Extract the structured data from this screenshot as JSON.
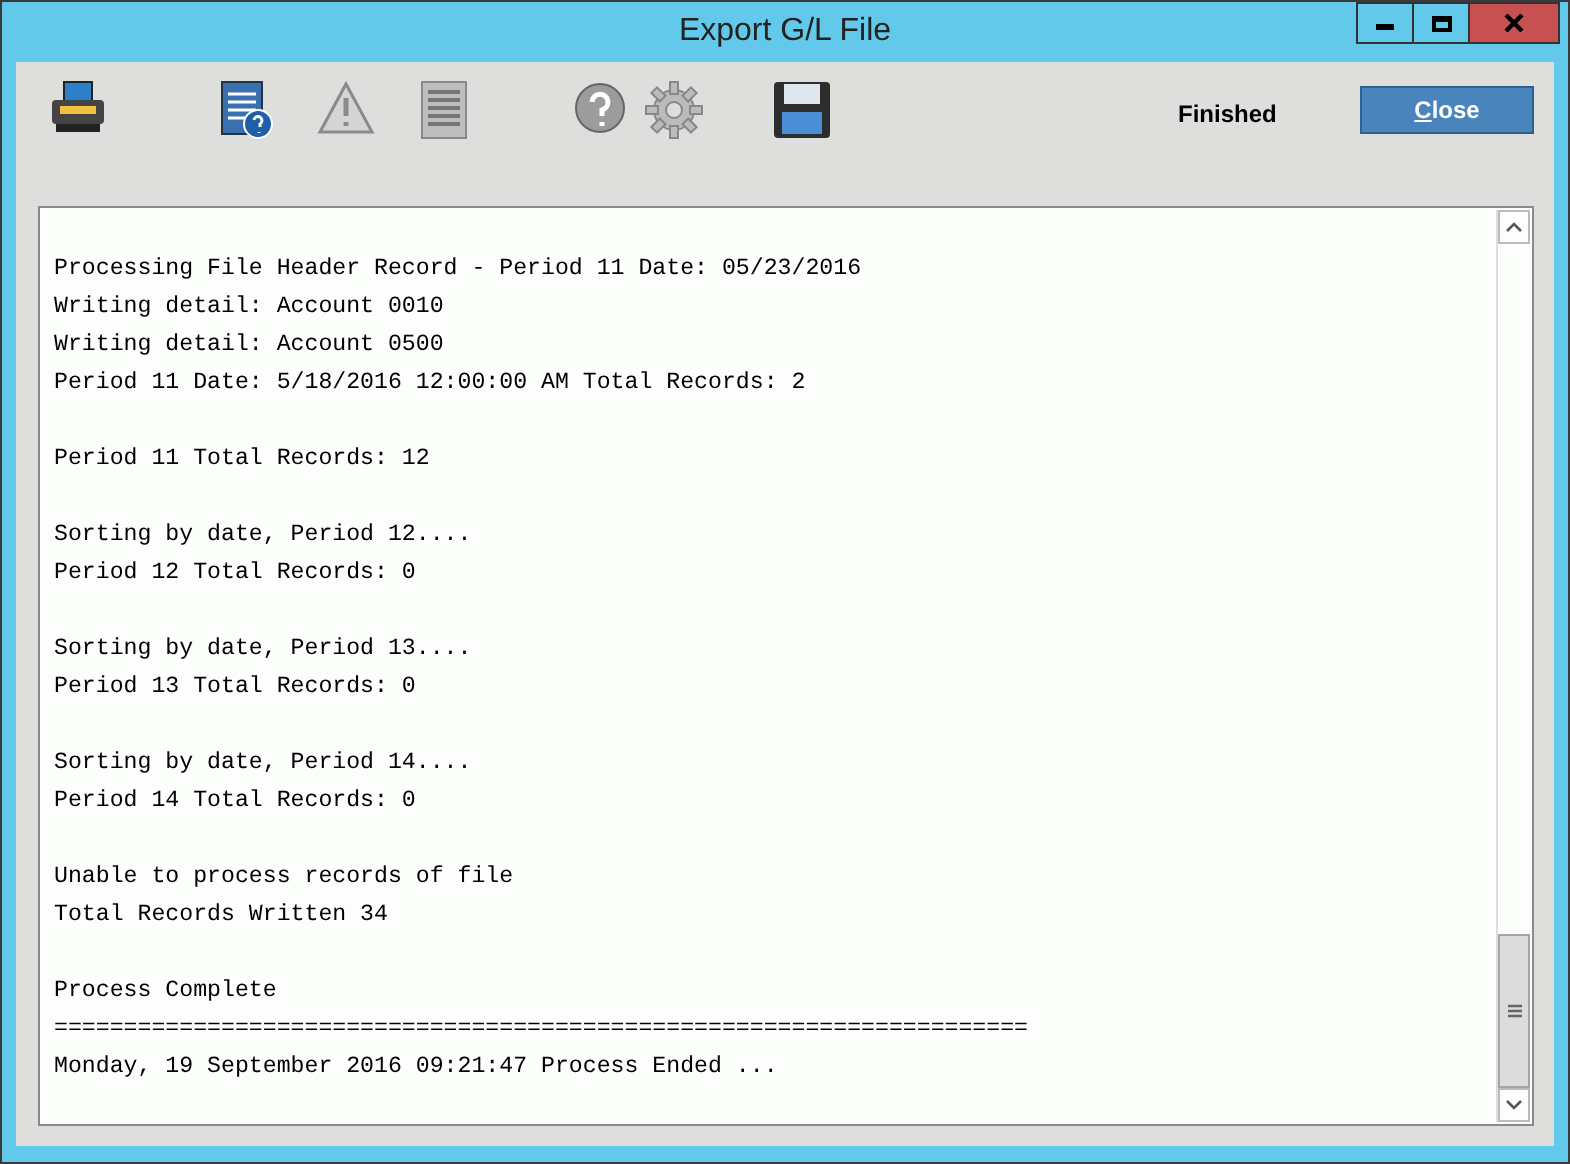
{
  "window": {
    "title": "Export G/L File"
  },
  "toolbar": [
    {
      "kind": "print",
      "disabled": false
    },
    {
      "kind": "report",
      "disabled": false
    },
    {
      "kind": "warning",
      "disabled": true
    },
    {
      "kind": "document",
      "disabled": true
    },
    {
      "kind": "help",
      "disabled": true
    },
    {
      "kind": "settings",
      "disabled": true
    },
    {
      "kind": "save",
      "disabled": false
    }
  ],
  "status": "Finished",
  "close_button": {
    "accelerator": "C",
    "rest": "lose"
  },
  "log": [
    [
      "Processing File Header Record - Period 11 Date: 05/23/2016",
      "Writing detail: Account 0010",
      "Writing detail: Account 0500",
      "Period 11 Date: 5/18/2016 12:00:00 AM Total Records: 2"
    ],
    [
      "Period 11 Total Records: 12"
    ],
    [
      "Sorting by date, Period 12....",
      "Period 12 Total Records: 0"
    ],
    [
      "Sorting by date, Period 13....",
      "Period 13 Total Records: 0"
    ],
    [
      "Sorting by date, Period 14....",
      "Period 14 Total Records: 0"
    ],
    [
      "Unable to process records of file",
      "Total Records Written 34"
    ],
    [
      "Process Complete",
      "======================================================================",
      "Monday, 19 September 2016 09:21:47 Process Ended ..."
    ]
  ]
}
